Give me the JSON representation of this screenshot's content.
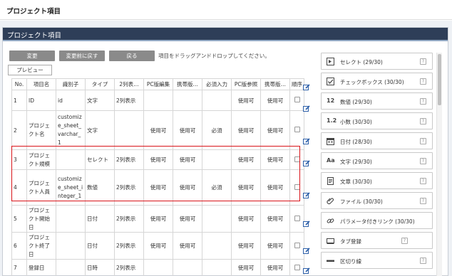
{
  "window": {
    "title": "プロジェクト項目"
  },
  "panel": {
    "title": "プロジェクト項目"
  },
  "toolbar": {
    "change_label": "変更",
    "revert_label": "変更前に戻す",
    "back_label": "戻る",
    "hint": "項目をドラッグアンドドロップしてください。",
    "preview_label": "プレビュー"
  },
  "table": {
    "headers": [
      "No.",
      "項目名",
      "識別子",
      "タイプ",
      "2列表…",
      "PC版編集",
      "携帯版…",
      "必須入力",
      "PC版参照",
      "携帯版…",
      "順序"
    ],
    "rows": [
      {
        "no": "1",
        "name": "ID",
        "id": "id",
        "type": "文字",
        "cols2": "2列表示",
        "pc_edit": "",
        "mb_edit": "",
        "req": "",
        "pc_ref": "使用可",
        "mb_ref": "使用可"
      },
      {
        "no": "2",
        "name": "プロジェクト名",
        "id": "customize_sheet_varchar_1",
        "type": "文字",
        "cols2": "",
        "pc_edit": "使用可",
        "mb_edit": "使用可",
        "req": "必須",
        "pc_ref": "使用可",
        "mb_ref": "使用可"
      },
      {
        "no": "3",
        "name": "プロジェクト規模",
        "id": "",
        "type": "セレクト",
        "cols2": "2列表示",
        "pc_edit": "使用可",
        "mb_edit": "使用可",
        "req": "",
        "pc_ref": "使用可",
        "mb_ref": "使用可"
      },
      {
        "no": "4",
        "name": "プロジェクト人員",
        "id": "customize_sheet_integer_1",
        "type": "数値",
        "cols2": "2列表示",
        "pc_edit": "使用可",
        "mb_edit": "使用可",
        "req": "必須",
        "pc_ref": "使用可",
        "mb_ref": "使用可"
      },
      {
        "no": "5",
        "name": "プロジェクト開始日",
        "id": "",
        "type": "日付",
        "cols2": "2列表示",
        "pc_edit": "使用可",
        "mb_edit": "使用可",
        "req": "",
        "pc_ref": "使用可",
        "mb_ref": "使用可"
      },
      {
        "no": "6",
        "name": "プロジェクト終了日",
        "id": "",
        "type": "日付",
        "cols2": "2列表示",
        "pc_edit": "使用可",
        "mb_edit": "使用可",
        "req": "",
        "pc_ref": "使用可",
        "mb_ref": "使用可"
      },
      {
        "no": "7",
        "name": "登録日",
        "id": "",
        "type": "日時",
        "cols2": "2列表示",
        "pc_edit": "",
        "mb_edit": "",
        "req": "",
        "pc_ref": "使用可",
        "mb_ref": "使用可"
      }
    ]
  },
  "palette": {
    "items": [
      {
        "label": "セレクト (29/30)",
        "icon": "select-icon"
      },
      {
        "label": "チェックボックス (30/30)",
        "icon": "checkbox-icon"
      },
      {
        "label": "数値 (29/30)",
        "icon": "number-icon"
      },
      {
        "label": "小数 (30/30)",
        "icon": "decimal-icon"
      },
      {
        "label": "日付 (28/30)",
        "icon": "calendar-icon"
      },
      {
        "label": "文字 (29/30)",
        "icon": "text-icon"
      },
      {
        "label": "文章 (30/30)",
        "icon": "document-icon"
      },
      {
        "label": "ファイル (30/30)",
        "icon": "file-icon"
      },
      {
        "label": "パラメータ付きリンク (30/30)",
        "icon": "link-icon"
      },
      {
        "label": "タブ登録",
        "icon": "tab-icon"
      },
      {
        "label": "区切り線",
        "icon": "divider-icon"
      }
    ],
    "glyphs": {
      "number": "12",
      "decimal": "1.2",
      "text": "Aa"
    },
    "help_glyph": "?"
  },
  "colors": {
    "header_bg": "#2e3e58",
    "button_gray": "#8a8a8a",
    "highlight": "#d9141a",
    "edit_icon": "#2b5ea8"
  }
}
